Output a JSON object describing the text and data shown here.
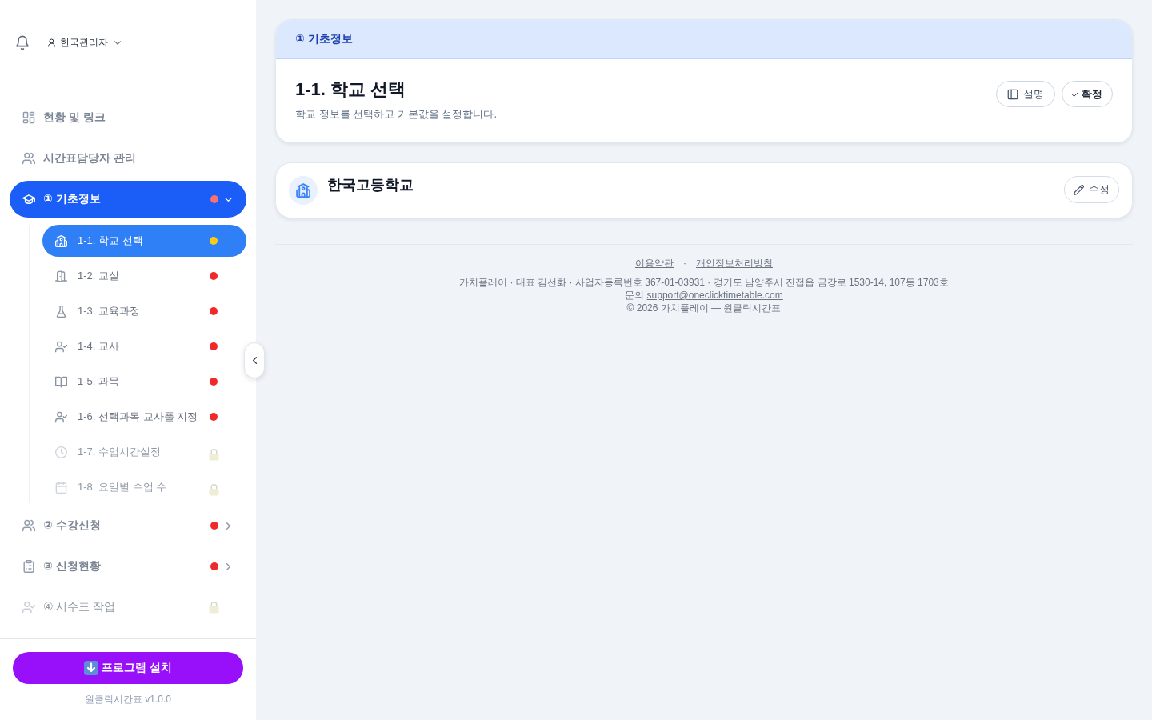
{
  "sidebar": {
    "user": {
      "name": "한국관리자"
    },
    "items": [
      {
        "kind": "link",
        "label": "현황 및 링크",
        "selected": false,
        "locked": false
      },
      {
        "kind": "link",
        "label": "시간표담당자 관리",
        "selected": false,
        "locked": false
      },
      {
        "kind": "group",
        "label": "① 기초정보",
        "selected": true,
        "locked": false,
        "expanded": true,
        "color": "#f87171",
        "children": [
          {
            "label": "1-1. 학교 선택",
            "selected": true,
            "locked": false,
            "color": "#facc15"
          },
          {
            "label": "1-2. 교실",
            "selected": false,
            "locked": false,
            "color": "#f02a2a"
          },
          {
            "label": "1-3. 교육과정",
            "selected": false,
            "locked": false,
            "color": "#f02a2a"
          },
          {
            "label": "1-4. 교사",
            "selected": false,
            "locked": false,
            "color": "#f02a2a"
          },
          {
            "label": "1-5. 과목",
            "selected": false,
            "locked": false,
            "color": "#f02a2a"
          },
          {
            "label": "1-6. 선택과목 교사풀 지정",
            "selected": false,
            "locked": false,
            "color": "#f02a2a"
          },
          {
            "label": "1-7. 수업시간설정",
            "selected": false,
            "locked": true
          },
          {
            "label": "1-8. 요일별 수업 수",
            "selected": false,
            "locked": true
          }
        ]
      },
      {
        "kind": "group",
        "label": "② 수강신청",
        "selected": false,
        "locked": false,
        "expanded": false,
        "color": "#f02a2a"
      },
      {
        "kind": "group",
        "label": "③ 신청현황",
        "selected": false,
        "locked": false,
        "expanded": false,
        "color": "#f02a2a"
      },
      {
        "kind": "group",
        "label": "④ 시수표 작업",
        "selected": false,
        "locked": true
      }
    ],
    "install_button": {
      "label": "프로그램 설치"
    },
    "version": "원클릭시간표 v1.0.0"
  },
  "section": {
    "title": "① 기초정보",
    "heading": "1-1. 학교 선택",
    "description": "학교 정보를 선택하고 기본값을 설정합니다.",
    "buttons": [
      {
        "kind": "guide",
        "label": "설명"
      },
      {
        "kind": "confirm",
        "label": "확정"
      }
    ]
  },
  "school": {
    "name": "한국고등학교",
    "button": "수정"
  },
  "footer": {
    "links": [
      "이용약관",
      "개인정보처리방침"
    ],
    "separator": "·",
    "company": "가치플레이 · 대표 김선화 · 사업자등록번호 367-01-03931 · 경기도 남양주시 진접읍 금강로 1530-14, 107동 1703호",
    "contact_label": "문의",
    "contact_email": "support@oneclicktimetable.com",
    "copyright": "© 2026 가치플레이 — 원클릭시간표"
  }
}
